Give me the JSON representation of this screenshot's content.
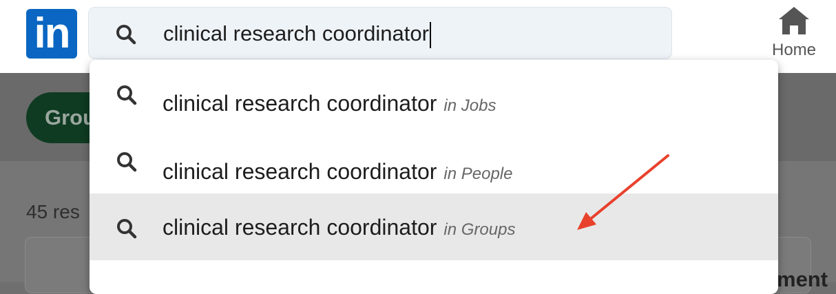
{
  "header": {
    "logo_text": "in",
    "search": {
      "value": "clinical research coordinator"
    },
    "home_label": "Home"
  },
  "background": {
    "filter_chip": "Grou",
    "results_count": "45 res",
    "right_partial_text": "ment"
  },
  "suggestions": [
    {
      "query": "clinical research coordinator",
      "context": "in Jobs",
      "highlighted": false
    },
    {
      "query": "clinical research coordinator",
      "context": "in People",
      "highlighted": false
    },
    {
      "query": "clinical research coordinator",
      "context": "in Groups",
      "highlighted": true
    }
  ],
  "annotation": {
    "arrow_color": "#e8412c"
  },
  "colors": {
    "brand": "#0a66c2",
    "highlight_row": "#e8e8e8"
  }
}
